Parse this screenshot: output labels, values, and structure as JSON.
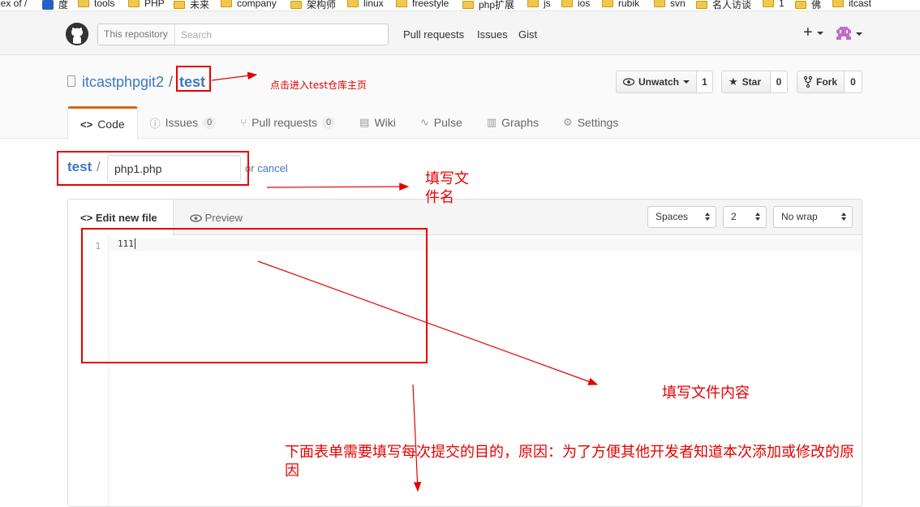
{
  "bookmarks": [
    {
      "label": "lex of /",
      "icon": "none"
    },
    {
      "label": "度",
      "icon": "baidu-paw-icon"
    },
    {
      "label": "tools",
      "icon": "folder-icon"
    },
    {
      "label": "PHP",
      "icon": "folder-icon"
    },
    {
      "label": "未来",
      "icon": "folder-icon"
    },
    {
      "label": "company",
      "icon": "folder-icon"
    },
    {
      "label": "架构师",
      "icon": "folder-icon"
    },
    {
      "label": "linux",
      "icon": "folder-icon"
    },
    {
      "label": "freestyle",
      "icon": "folder-icon"
    },
    {
      "label": "php扩展",
      "icon": "folder-icon"
    },
    {
      "label": "js",
      "icon": "folder-icon"
    },
    {
      "label": "ios",
      "icon": "folder-icon"
    },
    {
      "label": "rubik",
      "icon": "folder-icon"
    },
    {
      "label": "svn",
      "icon": "folder-icon"
    },
    {
      "label": "名人访谈",
      "icon": "folder-icon"
    },
    {
      "label": "1",
      "icon": "folder-icon"
    },
    {
      "label": "佛",
      "icon": "folder-icon"
    },
    {
      "label": "itcast",
      "icon": "folder-icon"
    }
  ],
  "header": {
    "search_scope": "This repository",
    "search_placeholder": "Search",
    "nav": [
      "Pull requests",
      "Issues",
      "Gist"
    ],
    "plus_label": "+"
  },
  "repo": {
    "owner": "itcastphpgit2",
    "separator": "/",
    "name": "test",
    "actions": {
      "watch_label": "Unwatch",
      "watch_count": "1",
      "star_label": "Star",
      "star_count": "0",
      "fork_label": "Fork",
      "fork_count": "0"
    }
  },
  "tabs": {
    "code": "Code",
    "issues": "Issues",
    "issues_count": "0",
    "pulls": "Pull requests",
    "pulls_count": "0",
    "wiki": "Wiki",
    "pulse": "Pulse",
    "graphs": "Graphs",
    "settings": "Settings"
  },
  "editor": {
    "crumb_root": "test",
    "crumb_sep": "/",
    "filename_value": "php1.php",
    "or_text": "or",
    "cancel_label": "cancel",
    "tab_edit": "Edit new file",
    "tab_preview": "Preview",
    "indent_mode": "Spaces",
    "indent_size": "2",
    "wrap_mode": "No wrap",
    "line_number": "1",
    "code_text": "111"
  },
  "annotations": {
    "enter_repo": "点击进入test仓库主页",
    "fill_filename": "填写文\n件名",
    "fill_content": "填写文件内容",
    "commit_note": "下面表单需要填写每次提交的目的，原因：为了方便其他开发者知道本次添加或修改的原\n因",
    "annotation_color": "#e60000"
  },
  "colors": {
    "link": "#4078c0",
    "tab_accent": "#d26911"
  }
}
